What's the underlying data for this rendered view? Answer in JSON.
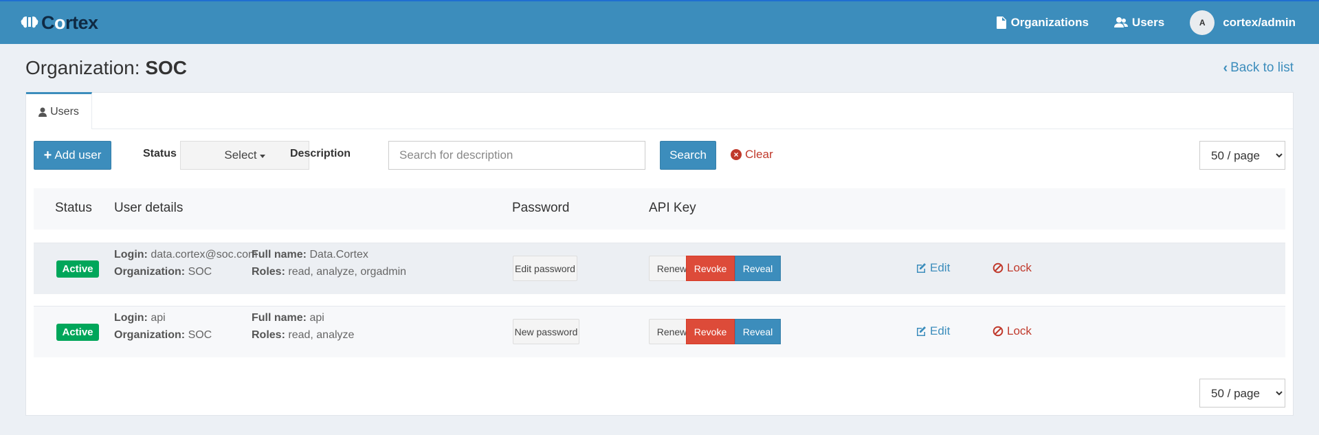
{
  "brand": {
    "name_pre": "C",
    "name_o": "o",
    "name_post": "rtex",
    "accent": "#3c8dbc"
  },
  "nav": {
    "organizations_label": "Organizations",
    "users_label": "Users",
    "avatar_letter": "A",
    "user_name": "cortex/admin"
  },
  "page": {
    "title_prefix": "Organization:",
    "title_org": "SOC",
    "back_label": "Back to list"
  },
  "tabs": [
    {
      "label": "Users",
      "active": true
    }
  ],
  "filters": {
    "add_user_label": "Add user",
    "status_label": "Status",
    "status_select": "Select",
    "description_label": "Description",
    "description_placeholder": "Search for description",
    "search_label": "Search",
    "clear_label": "Clear",
    "per_page": "50 / page"
  },
  "table": {
    "headers": [
      "Status",
      "User details",
      "Password",
      "API Key"
    ],
    "login_label": "Login:",
    "org_label": "Organization:",
    "fullname_label": "Full name:",
    "roles_label": "Roles:",
    "renew_label": "Renew",
    "revoke_label": "Revoke",
    "reveal_label": "Reveal",
    "edit_label": "Edit",
    "lock_label": "Lock",
    "rows": [
      {
        "status": "Active",
        "login": "data.cortex@soc.com",
        "organization": "SOC",
        "full_name": "Data.Cortex",
        "roles": "read, analyze, orgadmin",
        "password_action": "Edit password"
      },
      {
        "status": "Active",
        "login": "api",
        "organization": "SOC",
        "full_name": "api",
        "roles": "read, analyze",
        "password_action": "New password"
      }
    ]
  },
  "colors": {
    "status_active": "#00a65a",
    "danger": "#dd4b39",
    "primary": "#3c8dbc"
  }
}
